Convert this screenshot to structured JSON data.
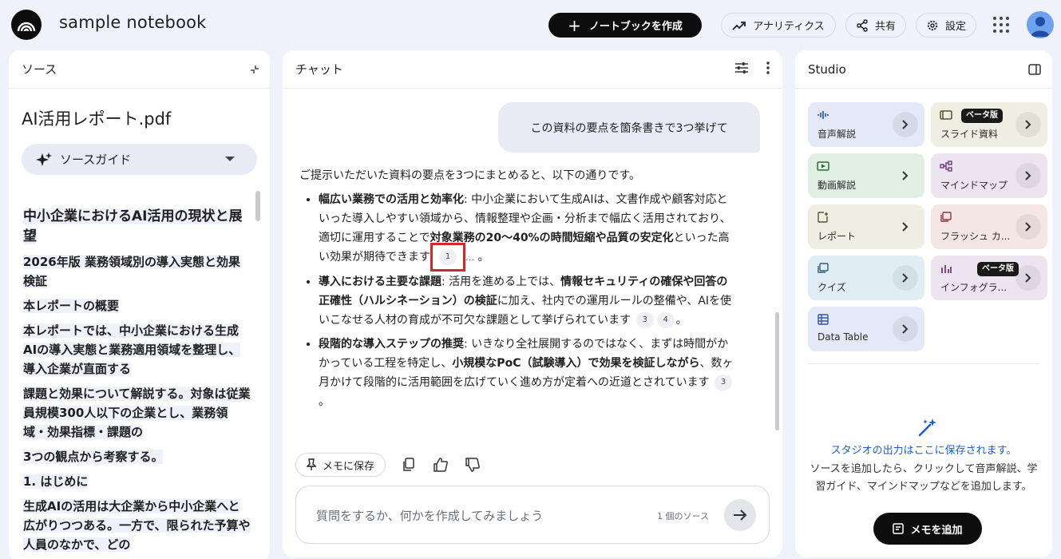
{
  "header": {
    "notebook_title": "sample notebook",
    "create_notebook_label": "ノートブックを作成",
    "analytics_label": "アナリティクス",
    "share_label": "共有",
    "settings_label": "設定"
  },
  "sources": {
    "panel_title": "ソース",
    "file_name": "AI活用レポート.pdf",
    "guide_label": "ソースガイド",
    "lines": [
      "中小企業におけるAI活用の現状と展望",
      "2026年版 業務領域別の導入実態と効果検証",
      "本レポートの概要",
      "本レポートでは、中小企業における生成AIの導入実態と業務適用領域を整理し、導入企業が直面する",
      "課題と効果について解説する。対象は従業員規模300人以下の企業とし、業務領域・効果指標・課題の",
      "3つの観点から考察する。",
      "1. はじめに",
      "生成AIの活用は大企業から中小企業へと広がりつつある。一方で、限られた予算や人員のなかで、どの"
    ]
  },
  "chat": {
    "panel_title": "チャット",
    "user_message": "この資料の要点を箇条書きで3つ挙げて",
    "answer_intro": "ご提示いただいた資料の要点を3つにまとめると、以下の通りです。",
    "bullets": [
      {
        "title": "幅広い業務での活用と効率化",
        "text_a": ": 中小企業において生成AIは、文書作成や顧客対応といった導入しやすい領域から、情報整理や企画・分析まで幅広く活用されており、適切に運用することで",
        "bold_a": "対象業務の20〜40%の時間短縮や品質の安定化",
        "text_b": "といった高い効果が期待できます",
        "cite_1": "1",
        "ellipsis": "…",
        "end": "。"
      },
      {
        "title": "導入における主要な課題",
        "text_a": ": 活用を進める上では、",
        "bold_a": "情報セキュリティの確保や回答の正確性（ハルシネーション）の検証",
        "text_b": "に加え、社内での運用ルールの整備や、AIを使いこなせる人材の育成が不可欠な課題として挙げられています",
        "cite_1": "3",
        "cite_2": "4",
        "end": "。"
      },
      {
        "title": "段階的な導入ステップの推奨",
        "text_a": ": いきなり全社展開するのではなく、まずは時間がかかっている工程を特定し、",
        "bold_a": "小規模なPoC（試験導入）で効果を検証しながら",
        "text_b": "、数ヶ月かけて段階的に活用範囲を広げていく進め方が定着への近道とされています",
        "cite_1": "3",
        "end": "。"
      }
    ],
    "save_memo_label": "メモに保存",
    "input_placeholder": "質問をするか、何かを作成してみましょう",
    "source_count": "1 個のソース"
  },
  "studio": {
    "panel_title": "Studio",
    "tiles": [
      {
        "label": "音声解説",
        "icon": "audio-wave-icon",
        "bg": "#e4e8f7"
      },
      {
        "label": "スライド資料",
        "icon": "slides-icon",
        "bg": "#efeee2",
        "badge": "ベータ版"
      },
      {
        "label": "動画解説",
        "icon": "video-icon",
        "bg": "#e1efe3"
      },
      {
        "label": "マインドマップ",
        "icon": "mindmap-icon",
        "bg": "#ece4ef"
      },
      {
        "label": "レポート",
        "icon": "report-icon",
        "bg": "#efeee2"
      },
      {
        "label": "フラッシュ カ...",
        "icon": "flashcard-icon",
        "bg": "#f5e6e6"
      },
      {
        "label": "クイズ",
        "icon": "quiz-icon",
        "bg": "#e1edf5"
      },
      {
        "label": "インフォグラ...",
        "icon": "infographic-icon",
        "bg": "#ece4ef",
        "badge": "ベータ版"
      },
      {
        "label": "Data Table",
        "icon": "data-table-icon",
        "bg": "#e4e8f7"
      }
    ],
    "empty_title": "スタジオの出力はここに保存されます。",
    "empty_desc": "ソースを追加したら、クリックして音声解説、学習ガイド、マインドマップなどを追加します。",
    "add_memo_label": "メモを追加"
  },
  "colors": {
    "background": "#f0f2fb",
    "accent_blue": "#1a5fd1",
    "citation_highlight": "#d9262c"
  }
}
